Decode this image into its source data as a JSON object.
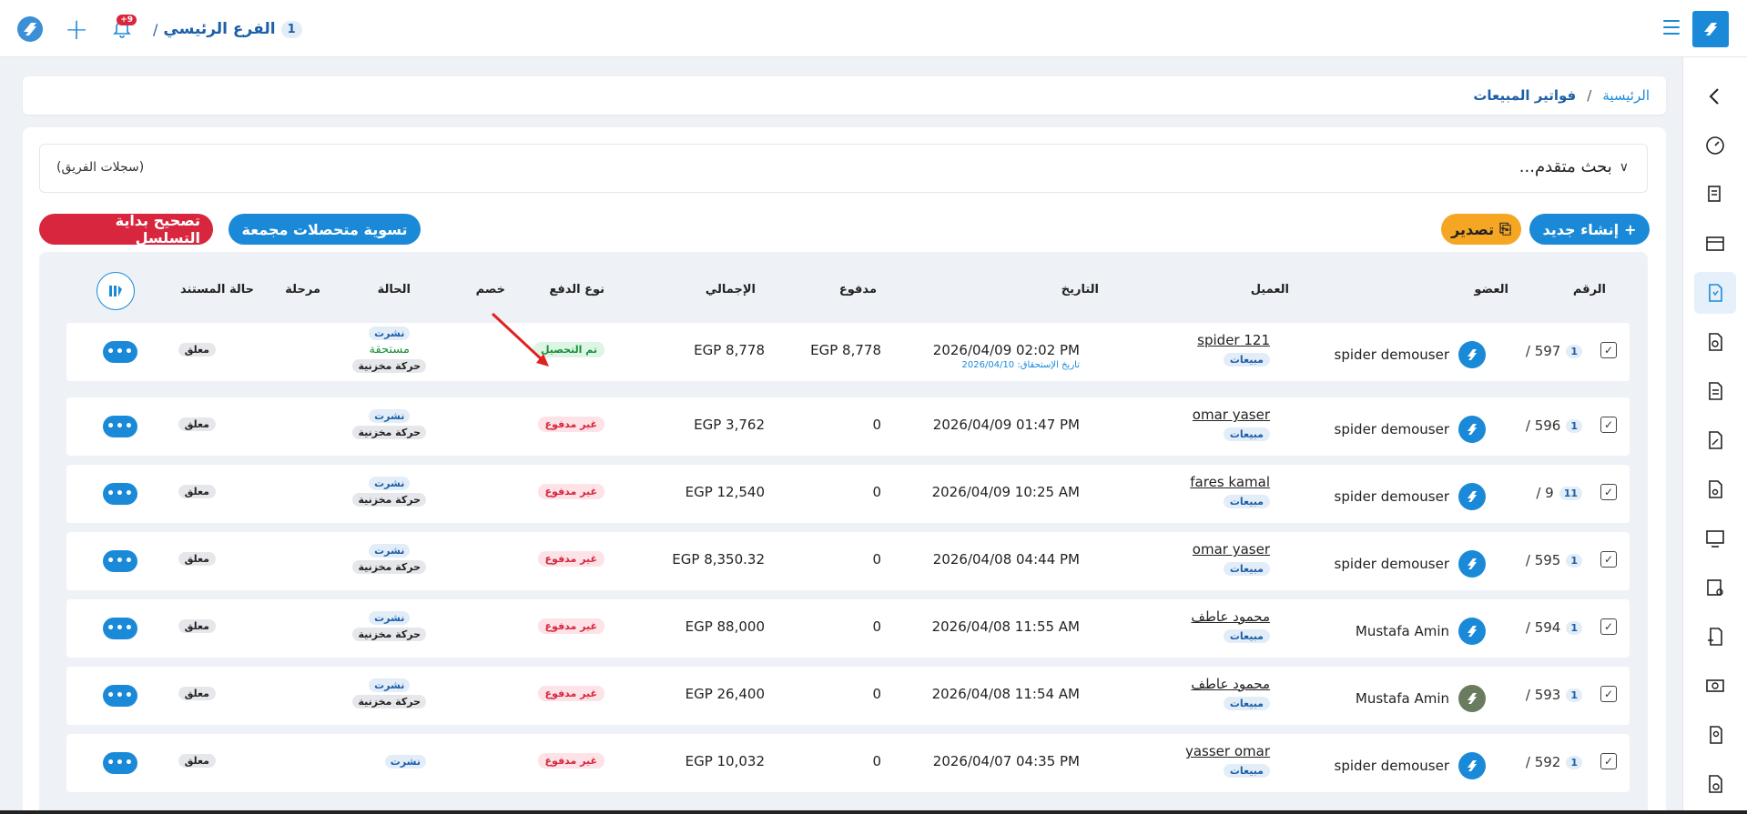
{
  "header": {
    "branch_number": "1",
    "branch_name": "الفرع الرئيسي",
    "branch_separator": "/",
    "notification_count": "+9"
  },
  "breadcrumb": {
    "home": "الرئيسية",
    "separator": "/",
    "current": "فواتير المبيعات"
  },
  "search": {
    "title": "بحث متقدم...",
    "team_records": "(سجلات الفريق)"
  },
  "actions": {
    "create_new": "إنشاء جديد",
    "export": "تصدير",
    "fix_sequence": "تصحيح بداية التسلسل",
    "settle_collections": "تسوية متحصلات مجمعة"
  },
  "table": {
    "headers": {
      "number": "الرقم",
      "member": "العضو",
      "client": "العميل",
      "date": "التاريخ",
      "paid": "مدفوع",
      "total": "الإجمالي",
      "payment_type": "نوع الدفع",
      "discount": "خصم",
      "status": "الحالة",
      "stage": "مرحلة",
      "doc_state": "حالة المستند"
    },
    "rows": [
      {
        "prefix": "1",
        "number": "597 /",
        "member": "spider demouser",
        "client": "spider 121",
        "client_tag": "مبيعات",
        "date": "2026/04/09 02:02 PM",
        "due": "تاريخ الإستحقاق: 2026/04/10",
        "paid": "EGP 8,778",
        "total": "EGP 8,778",
        "payment_type": "تم التحصيل",
        "status_pub": "نشرت",
        "status_due": "مستحقة",
        "status_stock": "حركة مخزنية",
        "doc_state": "معلق"
      },
      {
        "prefix": "1",
        "number": "596 /",
        "member": "spider demouser",
        "client": "omar yaser",
        "client_tag": "مبيعات",
        "date": "2026/04/09 01:47 PM",
        "due": "",
        "paid": "0",
        "total": "EGP 3,762",
        "payment_type": "غير مدفوع",
        "status_pub": "نشرت",
        "status_due": "",
        "status_stock": "حركة مخزنية",
        "doc_state": "معلق"
      },
      {
        "prefix": "11",
        "number": "9 /",
        "member": "spider demouser",
        "client": "fares kamal",
        "client_tag": "مبيعات",
        "date": "2026/04/09 10:25 AM",
        "due": "",
        "paid": "0",
        "total": "EGP 12,540",
        "payment_type": "غير مدفوع",
        "status_pub": "نشرت",
        "status_due": "",
        "status_stock": "حركة مخزنية",
        "doc_state": "معلق"
      },
      {
        "prefix": "1",
        "number": "595 /",
        "member": "spider demouser",
        "client": "omar yaser",
        "client_tag": "مبيعات",
        "date": "2026/04/08 04:44 PM",
        "due": "",
        "paid": "0",
        "total": "EGP 8,350.32",
        "payment_type": "غير مدفوع",
        "status_pub": "نشرت",
        "status_due": "",
        "status_stock": "حركة مخزنية",
        "doc_state": "معلق"
      },
      {
        "prefix": "1",
        "number": "594 /",
        "member": "Mustafa Amin",
        "client": "محمود عاطف",
        "client_tag": "مبيعات",
        "date": "2026/04/08 11:55 AM",
        "due": "",
        "paid": "0",
        "total": "EGP 88,000",
        "payment_type": "غير مدفوع",
        "status_pub": "نشرت",
        "status_due": "",
        "status_stock": "حركة مخزنية",
        "doc_state": "معلق"
      },
      {
        "prefix": "1",
        "number": "593 /",
        "member": "Mustafa Amin",
        "client": "محمود عاطف",
        "client_tag": "مبيعات",
        "date": "2026/04/08 11:54 AM",
        "due": "",
        "paid": "0",
        "total": "EGP 26,400",
        "payment_type": "غير مدفوع",
        "status_pub": "نشرت",
        "status_due": "",
        "status_stock": "حركة مخزنية",
        "doc_state": "معلق"
      },
      {
        "prefix": "1",
        "number": "592 /",
        "member": "spider demouser",
        "client": "yasser omar",
        "client_tag": "مبيعات",
        "date": "2026/04/07 04:35 PM",
        "due": "",
        "paid": "0",
        "total": "EGP 10,032",
        "payment_type": "غير مدفوع",
        "status_pub": "نشرت",
        "status_due": "",
        "status_stock": "",
        "doc_state": "معلق"
      }
    ]
  },
  "colors": {
    "primary": "#1a8ad8",
    "danger": "#d7263d",
    "warning": "#f5a623",
    "success": "#1a8f3a"
  }
}
